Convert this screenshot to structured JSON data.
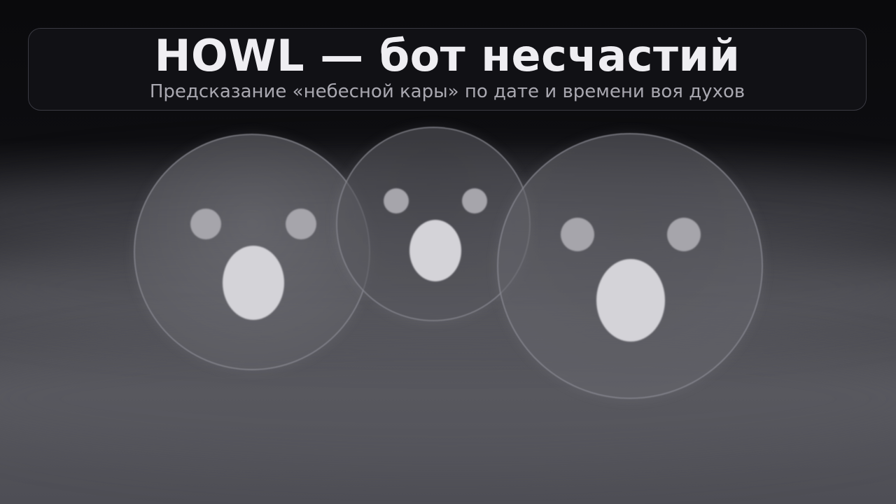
{
  "header": {
    "title": "HOWL — бот несчастий",
    "subtitle": "Предсказание «небесной кары» по дате и времени воя духов"
  },
  "icons": [
    "ghost-face-icon",
    "ghost-face-icon",
    "ghost-face-icon"
  ],
  "colors": {
    "background": "#0b0b0d",
    "title_text": "#efeef2",
    "subtitle_text": "#a9a8b0",
    "ghost_eye": "#a6a5ab",
    "ghost_mouth": "#d4d3d8"
  }
}
